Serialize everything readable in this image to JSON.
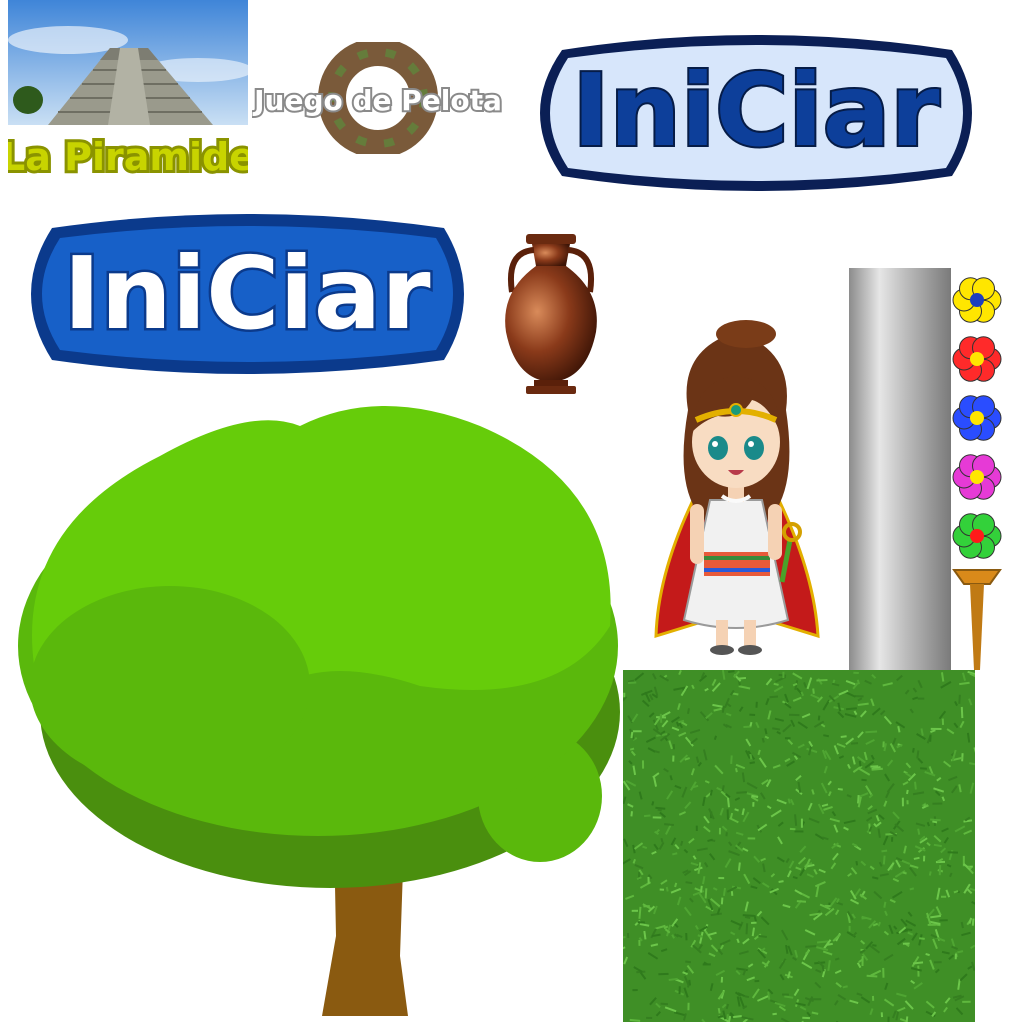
{
  "tiles": {
    "piramide": {
      "label": "La Piramide"
    },
    "pelota": {
      "label": "Juego de Pelota"
    }
  },
  "buttons": {
    "start_light": {
      "label": "IniCiar"
    },
    "start_dark": {
      "label": "IniCiar"
    }
  },
  "colors": {
    "sky": "#6aa8e6",
    "pyramid_label": "#c8d400",
    "start_light_fill": "#d7e6fb",
    "start_light_text": "#0d3f9a",
    "start_dark_fill": "#1760c8",
    "start_dark_outline": "#0b3a8c",
    "tree_light": "#66cc0a",
    "tree_mid": "#5ab80c",
    "tree_dark": "#4a8f0e",
    "trunk": "#8a5a10",
    "grass": "#3f8f26",
    "pillar": "#b9b9b9",
    "vase": "#8a3a1a"
  },
  "sprites": {
    "flowers": [
      {
        "name": "yellow-flower",
        "petal": "#ffe600",
        "center": "#1d3fbf"
      },
      {
        "name": "red-flower",
        "petal": "#ff2a2a",
        "center": "#ffe600"
      },
      {
        "name": "blue-flower",
        "petal": "#2a4dff",
        "center": "#ffe600"
      },
      {
        "name": "magenta-flower",
        "petal": "#e63ad6",
        "center": "#ffe600"
      },
      {
        "name": "green-flower",
        "petal": "#33d13a",
        "center": "#ff1a1a"
      }
    ]
  }
}
